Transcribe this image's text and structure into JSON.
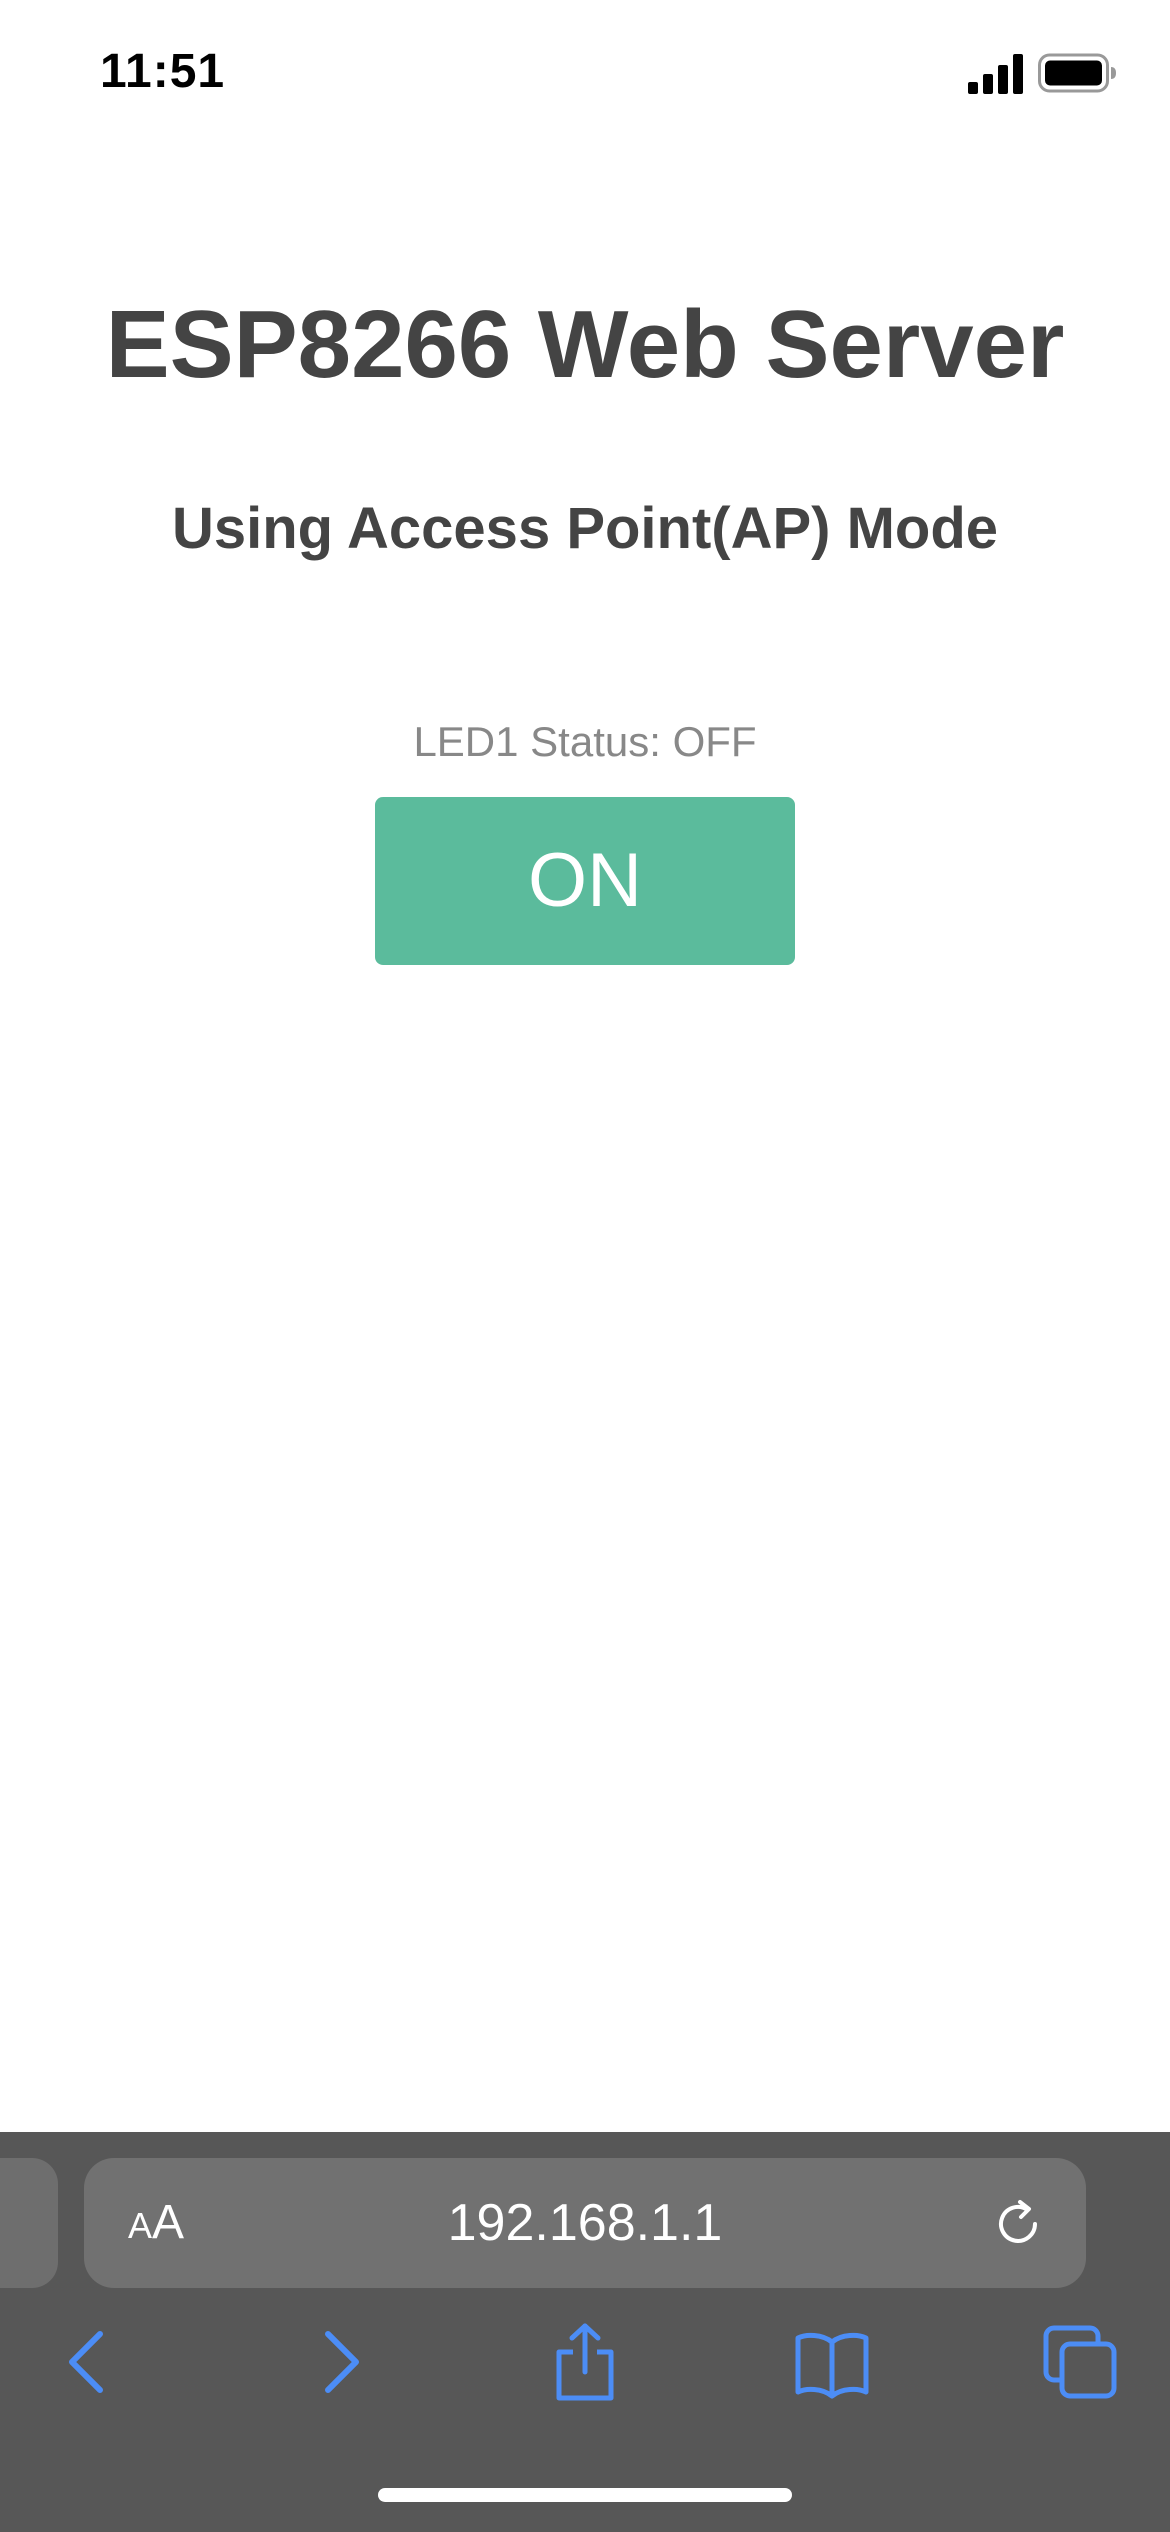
{
  "status_bar": {
    "time": "11:51"
  },
  "page": {
    "title": "ESP8266 Web Server",
    "subtitle": "Using Access Point(AP) Mode",
    "led_status": "LED1 Status: OFF",
    "button_label": "ON",
    "button_color": "#5bbb9c"
  },
  "browser": {
    "text_size_label_small": "A",
    "text_size_label_large": "A",
    "url": "192.168.1.1",
    "icons": [
      "reload-icon",
      "back-icon",
      "forward-icon",
      "share-icon",
      "bookmarks-icon",
      "tabs-icon"
    ],
    "accent_color": "#4c8df6"
  }
}
